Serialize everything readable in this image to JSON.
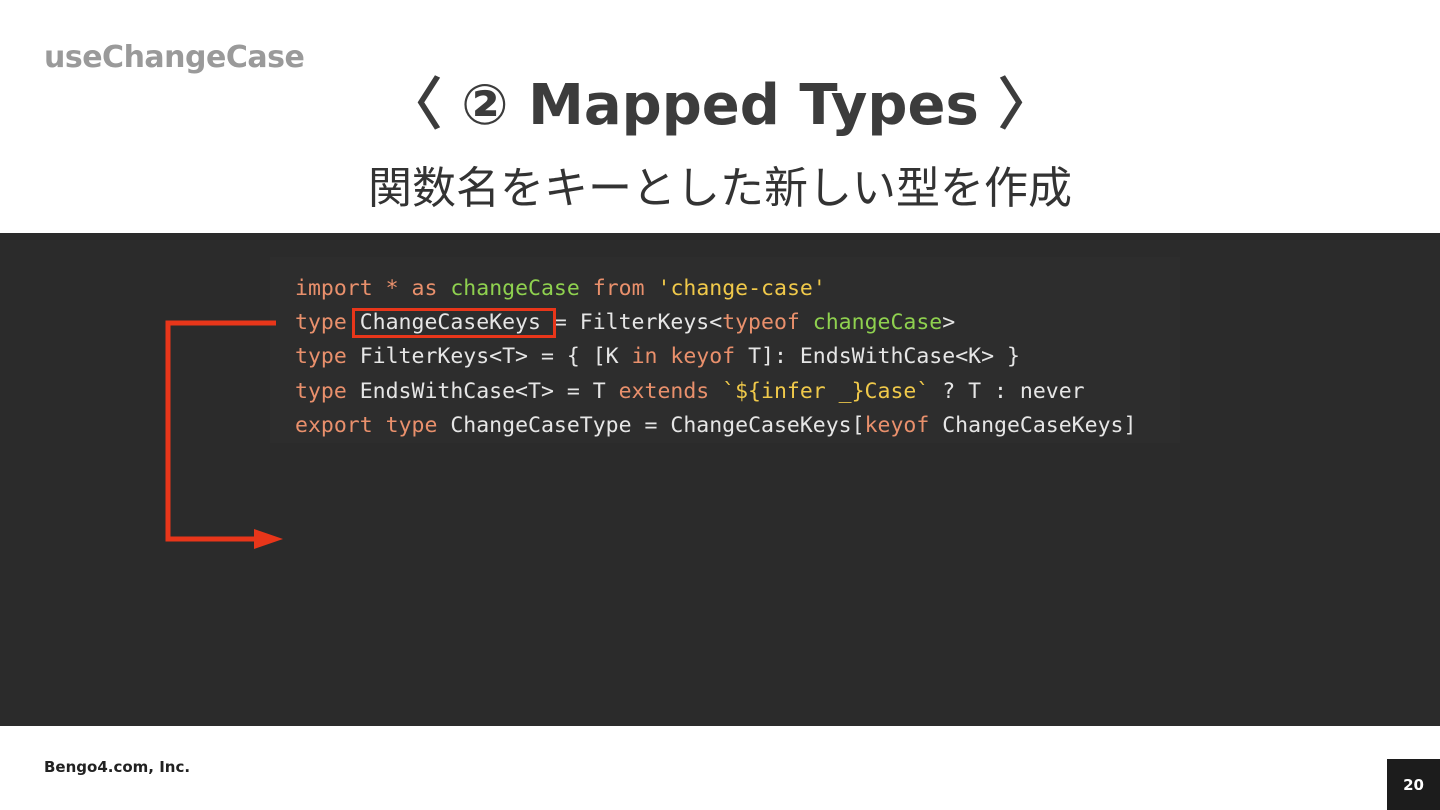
{
  "slide": {
    "section_label": "useChangeCase",
    "title": "〈 ② Mapped Types 〉",
    "subtitle": "関数名をキーとした新しい型を作成"
  },
  "code": {
    "line1": {
      "t1": "import",
      "t2": " * ",
      "t3": "as",
      "t4": " ",
      "t5": "changeCase",
      "t6": " ",
      "t7": "from",
      "t8": " ",
      "t9": "'change-case'"
    },
    "line2": {
      "t1": "type",
      "t2": " ChangeCaseKeys",
      "t3": " = FilterKeys<",
      "t4": "typeof",
      "t5": " ",
      "t6": "changeCase",
      "t7": ">"
    },
    "line3": {
      "t1": "type",
      "t2": " FilterKeys<T> = { [K ",
      "t3": "in",
      "t4": " ",
      "t5": "keyof",
      "t6": " T]: EndsWithCase<K> }"
    },
    "line4": {
      "t1": "type",
      "t2": " EndsWithCase<T> = T ",
      "t3": "extends",
      "t4": " ",
      "t5": "`${infer _}Case`",
      "t6": " ? T : never"
    },
    "line5": {
      "t1": "export",
      "t2": " ",
      "t3": "type",
      "t4": " ChangeCaseType = ChangeCaseKeys[",
      "t5": "keyof",
      "t6": " ChangeCaseKeys]"
    }
  },
  "footer": {
    "company": "Bengo4.com, Inc.",
    "page_number": "20"
  },
  "colors": {
    "keyword": "#e9906c",
    "identifier": "#8fd14f",
    "string": "#f0c94a",
    "annotation": "#e8361a",
    "panel_bg": "#2b2b2b"
  }
}
